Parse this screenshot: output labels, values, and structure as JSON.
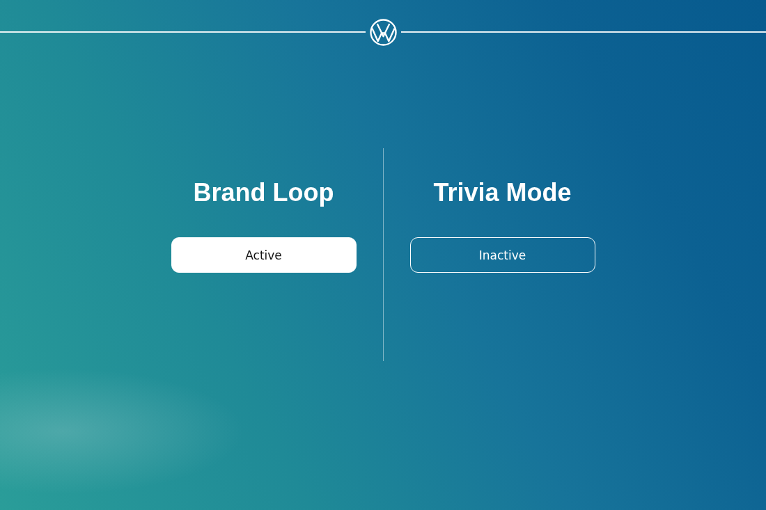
{
  "modes": [
    {
      "title": "Brand Loop",
      "status": "Active",
      "active": true
    },
    {
      "title": "Trivia Mode",
      "status": "Inactive",
      "active": false
    }
  ]
}
